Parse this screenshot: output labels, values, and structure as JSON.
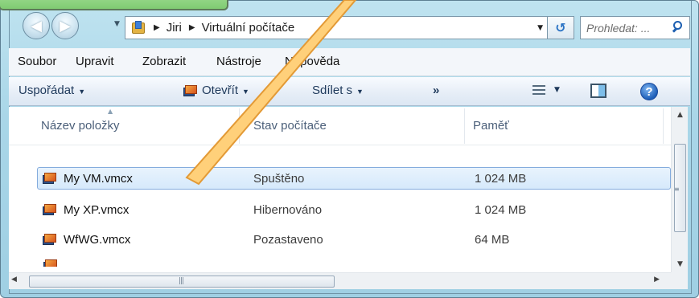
{
  "address_bar": {
    "breadcrumbs": [
      "Jiri",
      "Virtuální počítače"
    ]
  },
  "search": {
    "placeholder": "Prohledat: ..."
  },
  "menu": {
    "items": [
      "Soubor",
      "Upravit",
      "Zobrazit",
      "Nástroje",
      "Nápověda"
    ]
  },
  "toolbar": {
    "organize_label": "Uspořádat",
    "open_label": "Otevřít",
    "share_label": "Sdílet s",
    "more_label": "»",
    "help_label": "?"
  },
  "file_list": {
    "columns": [
      "Název položky",
      "Stav počítače",
      "Paměť"
    ],
    "rows": [
      {
        "name": "My VM.vmcx",
        "state": "Spuštěno",
        "memory": "1 024 MB",
        "selected": true
      },
      {
        "name": "My XP.vmcx",
        "state": "Hibernováno",
        "memory": "1 024 MB",
        "selected": false
      },
      {
        "name": "WfWG.vmcx",
        "state": "Pozastaveno",
        "memory": "64 MB",
        "selected": false
      }
    ]
  },
  "icons": {
    "nav": [
      "back-arrow-icon",
      "forward-arrow-icon"
    ],
    "vm": "virtual-machine-icon",
    "folder": "virtual-pc-folder-icon"
  },
  "colors": {
    "frame": "#a9d6e8",
    "selection_fill": "#d6e9fb",
    "selection_border": "#84acdd",
    "callout": "#8ed081",
    "command_text": "#1e395b"
  }
}
